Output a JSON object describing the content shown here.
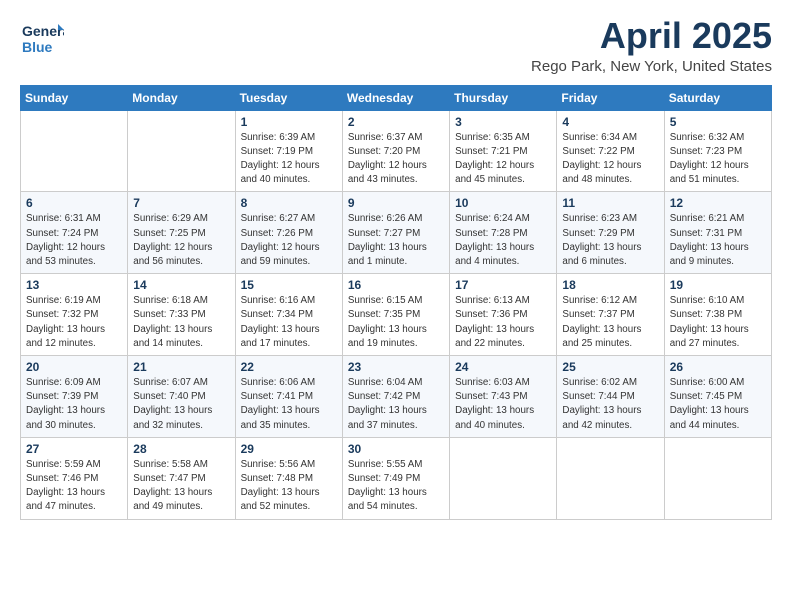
{
  "header": {
    "logo_line1": "General",
    "logo_line2": "Blue",
    "title": "April 2025",
    "subtitle": "Rego Park, New York, United States"
  },
  "weekdays": [
    "Sunday",
    "Monday",
    "Tuesday",
    "Wednesday",
    "Thursday",
    "Friday",
    "Saturday"
  ],
  "weeks": [
    [
      {
        "day": "",
        "detail": ""
      },
      {
        "day": "",
        "detail": ""
      },
      {
        "day": "1",
        "detail": "Sunrise: 6:39 AM\nSunset: 7:19 PM\nDaylight: 12 hours\nand 40 minutes."
      },
      {
        "day": "2",
        "detail": "Sunrise: 6:37 AM\nSunset: 7:20 PM\nDaylight: 12 hours\nand 43 minutes."
      },
      {
        "day": "3",
        "detail": "Sunrise: 6:35 AM\nSunset: 7:21 PM\nDaylight: 12 hours\nand 45 minutes."
      },
      {
        "day": "4",
        "detail": "Sunrise: 6:34 AM\nSunset: 7:22 PM\nDaylight: 12 hours\nand 48 minutes."
      },
      {
        "day": "5",
        "detail": "Sunrise: 6:32 AM\nSunset: 7:23 PM\nDaylight: 12 hours\nand 51 minutes."
      }
    ],
    [
      {
        "day": "6",
        "detail": "Sunrise: 6:31 AM\nSunset: 7:24 PM\nDaylight: 12 hours\nand 53 minutes."
      },
      {
        "day": "7",
        "detail": "Sunrise: 6:29 AM\nSunset: 7:25 PM\nDaylight: 12 hours\nand 56 minutes."
      },
      {
        "day": "8",
        "detail": "Sunrise: 6:27 AM\nSunset: 7:26 PM\nDaylight: 12 hours\nand 59 minutes."
      },
      {
        "day": "9",
        "detail": "Sunrise: 6:26 AM\nSunset: 7:27 PM\nDaylight: 13 hours\nand 1 minute."
      },
      {
        "day": "10",
        "detail": "Sunrise: 6:24 AM\nSunset: 7:28 PM\nDaylight: 13 hours\nand 4 minutes."
      },
      {
        "day": "11",
        "detail": "Sunrise: 6:23 AM\nSunset: 7:29 PM\nDaylight: 13 hours\nand 6 minutes."
      },
      {
        "day": "12",
        "detail": "Sunrise: 6:21 AM\nSunset: 7:31 PM\nDaylight: 13 hours\nand 9 minutes."
      }
    ],
    [
      {
        "day": "13",
        "detail": "Sunrise: 6:19 AM\nSunset: 7:32 PM\nDaylight: 13 hours\nand 12 minutes."
      },
      {
        "day": "14",
        "detail": "Sunrise: 6:18 AM\nSunset: 7:33 PM\nDaylight: 13 hours\nand 14 minutes."
      },
      {
        "day": "15",
        "detail": "Sunrise: 6:16 AM\nSunset: 7:34 PM\nDaylight: 13 hours\nand 17 minutes."
      },
      {
        "day": "16",
        "detail": "Sunrise: 6:15 AM\nSunset: 7:35 PM\nDaylight: 13 hours\nand 19 minutes."
      },
      {
        "day": "17",
        "detail": "Sunrise: 6:13 AM\nSunset: 7:36 PM\nDaylight: 13 hours\nand 22 minutes."
      },
      {
        "day": "18",
        "detail": "Sunrise: 6:12 AM\nSunset: 7:37 PM\nDaylight: 13 hours\nand 25 minutes."
      },
      {
        "day": "19",
        "detail": "Sunrise: 6:10 AM\nSunset: 7:38 PM\nDaylight: 13 hours\nand 27 minutes."
      }
    ],
    [
      {
        "day": "20",
        "detail": "Sunrise: 6:09 AM\nSunset: 7:39 PM\nDaylight: 13 hours\nand 30 minutes."
      },
      {
        "day": "21",
        "detail": "Sunrise: 6:07 AM\nSunset: 7:40 PM\nDaylight: 13 hours\nand 32 minutes."
      },
      {
        "day": "22",
        "detail": "Sunrise: 6:06 AM\nSunset: 7:41 PM\nDaylight: 13 hours\nand 35 minutes."
      },
      {
        "day": "23",
        "detail": "Sunrise: 6:04 AM\nSunset: 7:42 PM\nDaylight: 13 hours\nand 37 minutes."
      },
      {
        "day": "24",
        "detail": "Sunrise: 6:03 AM\nSunset: 7:43 PM\nDaylight: 13 hours\nand 40 minutes."
      },
      {
        "day": "25",
        "detail": "Sunrise: 6:02 AM\nSunset: 7:44 PM\nDaylight: 13 hours\nand 42 minutes."
      },
      {
        "day": "26",
        "detail": "Sunrise: 6:00 AM\nSunset: 7:45 PM\nDaylight: 13 hours\nand 44 minutes."
      }
    ],
    [
      {
        "day": "27",
        "detail": "Sunrise: 5:59 AM\nSunset: 7:46 PM\nDaylight: 13 hours\nand 47 minutes."
      },
      {
        "day": "28",
        "detail": "Sunrise: 5:58 AM\nSunset: 7:47 PM\nDaylight: 13 hours\nand 49 minutes."
      },
      {
        "day": "29",
        "detail": "Sunrise: 5:56 AM\nSunset: 7:48 PM\nDaylight: 13 hours\nand 52 minutes."
      },
      {
        "day": "30",
        "detail": "Sunrise: 5:55 AM\nSunset: 7:49 PM\nDaylight: 13 hours\nand 54 minutes."
      },
      {
        "day": "",
        "detail": ""
      },
      {
        "day": "",
        "detail": ""
      },
      {
        "day": "",
        "detail": ""
      }
    ]
  ]
}
